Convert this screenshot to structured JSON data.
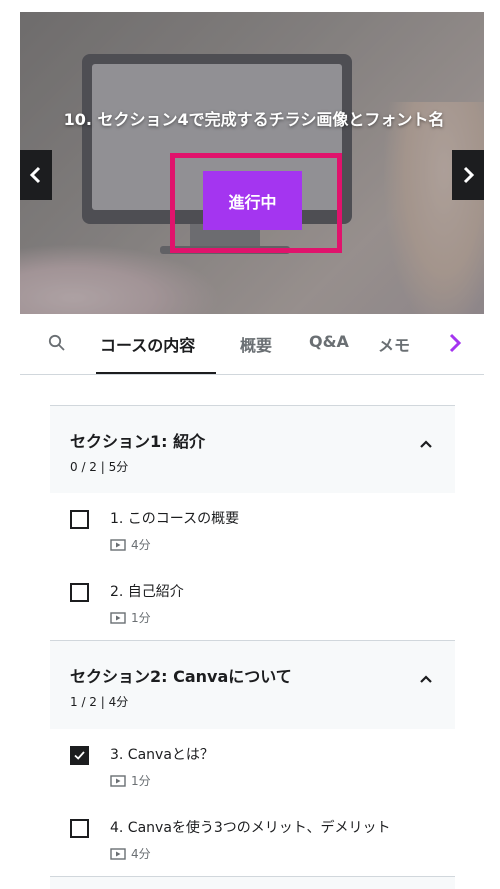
{
  "player": {
    "title": "10. セクション4で完成するチラシ画像とフォント名",
    "status_button": "進行中"
  },
  "tabs": {
    "items": [
      "コースの内容",
      "概要",
      "Q&A",
      "メモ"
    ],
    "active": "コースの内容"
  },
  "sections": [
    {
      "title": "セクション1: 紹介",
      "meta": "0 / 2 | 5分",
      "lectures": [
        {
          "title": "1. このコースの概要",
          "duration": "4分",
          "checked": false
        },
        {
          "title": "2. 自己紹介",
          "duration": "1分",
          "checked": false
        }
      ]
    },
    {
      "title": "セクション2: Canvaについて",
      "meta": "1 / 2 | 4分",
      "lectures": [
        {
          "title": "3. Canvaとは？",
          "duration": "1分",
          "checked": true
        },
        {
          "title": "4. Canvaを使う3つのメリット、デメリット",
          "duration": "4分",
          "checked": false
        }
      ]
    }
  ],
  "colors": {
    "accent": "#a435f0",
    "highlight_border": "#e0136c",
    "text": "#1c1d1f",
    "muted": "#6a6f73",
    "section_bg": "#f7f9fa"
  },
  "icons": {
    "search": "search-icon",
    "tab_next": "chevron-right-icon",
    "prev": "chevron-left-icon",
    "next": "chevron-right-icon",
    "collapse": "chevron-up-icon",
    "video": "video-icon",
    "check": "check-icon"
  }
}
